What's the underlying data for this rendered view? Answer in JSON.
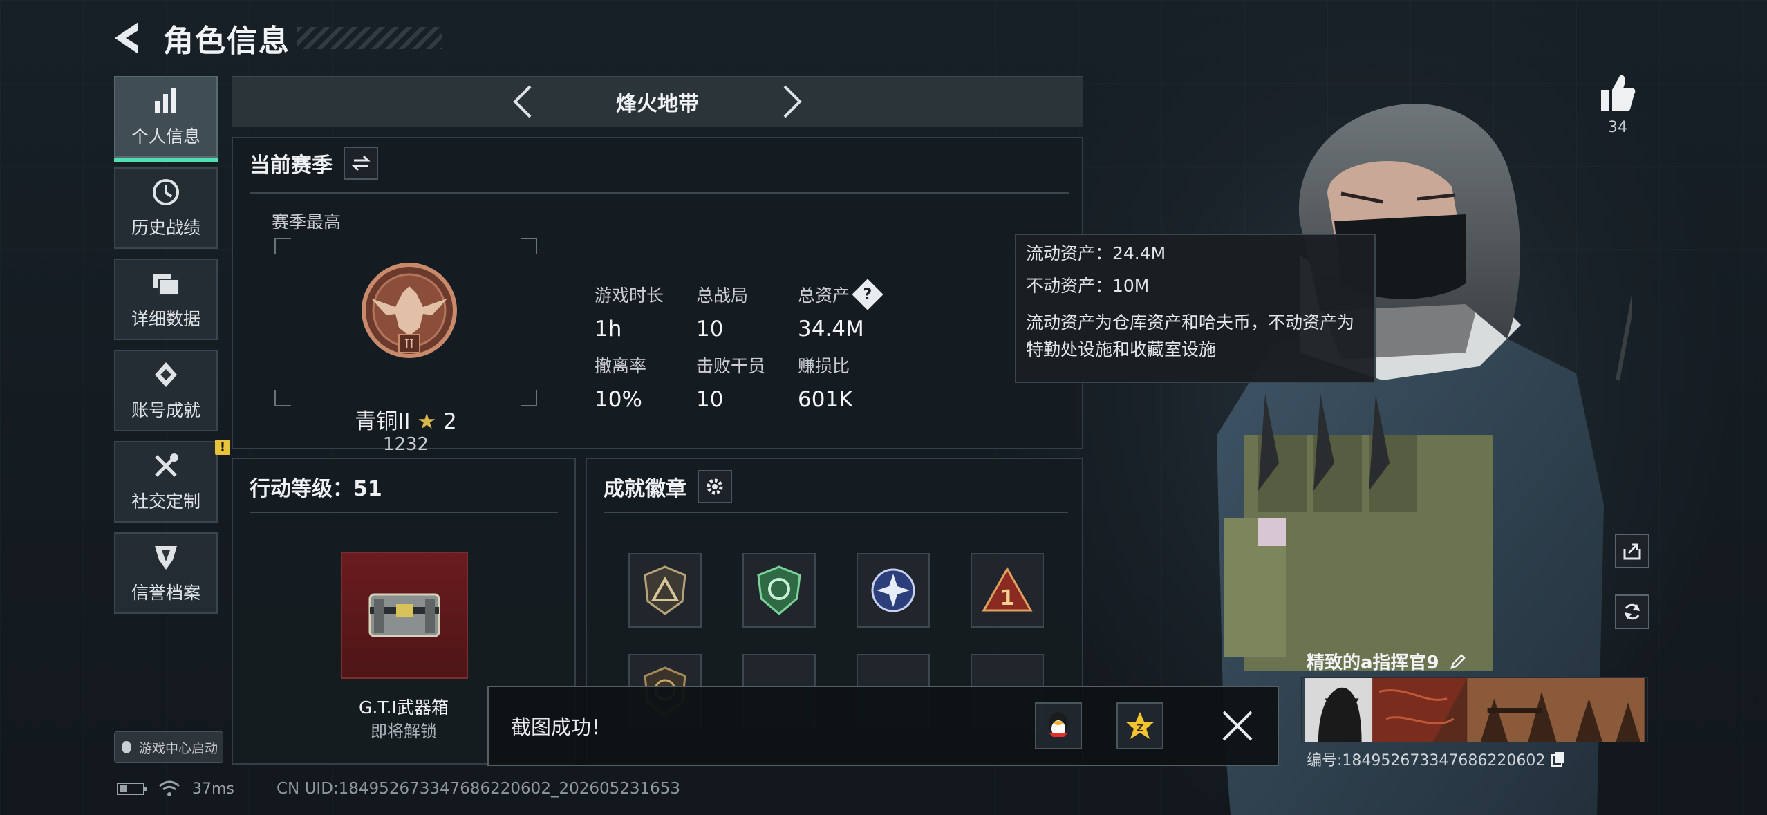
{
  "header": {
    "title": "角色信息"
  },
  "sidebar": {
    "items": [
      {
        "label": "个人信息",
        "icon": "bar-chart-icon",
        "active": true
      },
      {
        "label": "历史战绩",
        "icon": "history-clock-icon"
      },
      {
        "label": "详细数据",
        "icon": "folder-stack-icon"
      },
      {
        "label": "账号成就",
        "icon": "achievement-icon"
      },
      {
        "label": "社交定制",
        "icon": "tools-icon",
        "badge": "!"
      },
      {
        "label": "信誉档案",
        "icon": "shield-wing-icon"
      }
    ],
    "game_center": "游戏中心启动"
  },
  "mode_bar": {
    "title": "烽火地带"
  },
  "season": {
    "title": "当前赛季",
    "subtitle": "赛季最高",
    "rank_name": "青铜II",
    "rank_stars": "2",
    "rank_score": "1232",
    "stats": [
      {
        "label": "游戏时长",
        "value": "1h"
      },
      {
        "label": "总战局",
        "value": "10"
      },
      {
        "label": "总资产",
        "value": "34.4M"
      },
      {
        "label": "撤离率",
        "value": "10%"
      },
      {
        "label": "击败干员",
        "value": "10"
      },
      {
        "label": "赚损比",
        "value": "601K"
      }
    ]
  },
  "tooltip": {
    "liquid": "流动资产：24.4M",
    "fixed": "不动资产：10M",
    "desc": "流动资产为仓库资产和哈夫币，不动资产为特勤处设施和收藏室设施"
  },
  "level": {
    "title": "行动等级：51",
    "item_name": "G.T.I武器箱",
    "item_status": "即将解锁"
  },
  "badges": {
    "title": "成就徽章"
  },
  "toast": {
    "text": "截图成功！"
  },
  "status": {
    "ping": "37ms",
    "uid": "CN UID:18495267334768622060​2_202605231653"
  },
  "profile": {
    "likes": "34",
    "name": "精致的a指挥官9",
    "id": "编号:18495267334768622060​2"
  },
  "colors": {
    "accent": "#4ee0b0",
    "rank_bronze": "#a8624a",
    "level_box": "#6a1c1f",
    "warn": "#e8c43a"
  }
}
